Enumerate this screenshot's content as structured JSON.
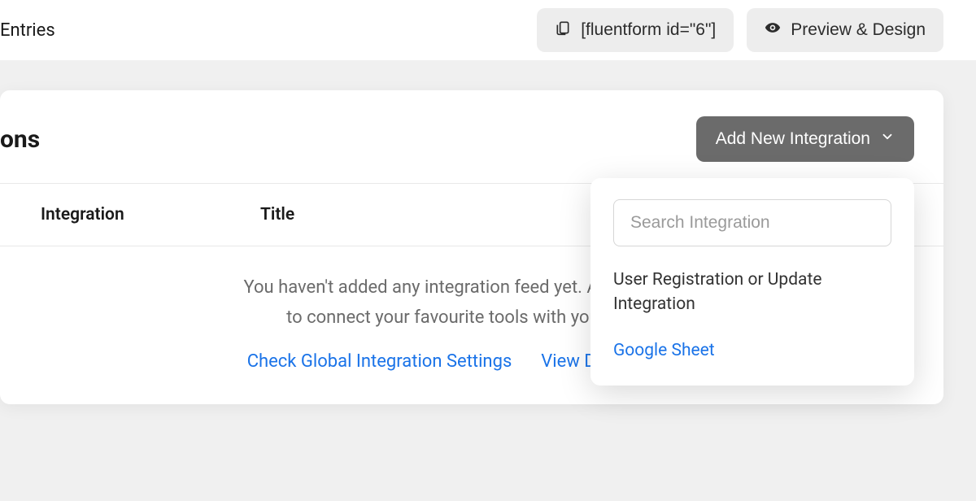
{
  "topbar": {
    "entries_label": "Entries",
    "shortcode_label": "[fluentform id=\"6\"]",
    "preview_label": "Preview & Design"
  },
  "panel": {
    "title_fragment": "ons",
    "add_button_label": "Add New Integration"
  },
  "table": {
    "columns": {
      "integration": "Integration",
      "title": "Title"
    }
  },
  "empty_state": {
    "line1": "You haven't added any integration feed yet. Add new integ",
    "line2": "to connect your favourite tools with your forms",
    "link_global": "Check Global Integration Settings",
    "link_docs": "View Documentatio"
  },
  "dropdown": {
    "search_placeholder": "Search Integration",
    "items": [
      {
        "label": "User Registration or Update Integration",
        "is_link": false
      },
      {
        "label": "Google Sheet",
        "is_link": true
      }
    ]
  }
}
